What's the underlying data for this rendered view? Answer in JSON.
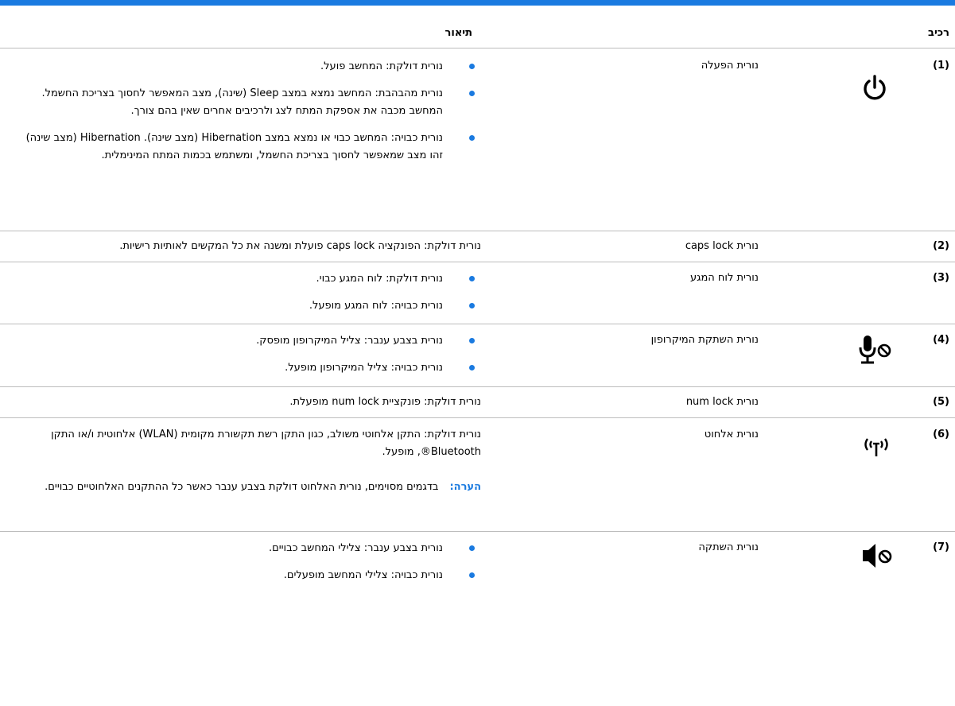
{
  "header": {
    "component": "רכיב",
    "description": "תיאור"
  },
  "rows": [
    {
      "num": "(1)",
      "component": "נורית הפעלה",
      "icon": "power-icon",
      "bullets": [
        "נורית דולקת: המחשב פועל.",
        "נורית מהבהבת: המחשב נמצא במצב Sleep (שינה), מצב המאפשר לחסוך בצריכת החשמל. המחשב מכבה את אספקת המתח לצג ולרכיבים אחרים שאין בהם צורך.",
        "נורית כבויה: המחשב כבוי או נמצא במצב Hibernation (מצב שינה). Hibernation (מצב שינה) זהו מצב שמאפשר לחסוך בצריכת החשמל, ומשתמש בכמות המתח המינימלית."
      ]
    },
    {
      "num": "(2)",
      "component": "נורית caps lock",
      "text": "נורית דולקת: הפונקציה caps lock פועלת ומשנה את כל המקשים לאותיות רישיות."
    },
    {
      "num": "(3)",
      "component": "נורית לוח המגע",
      "bullets": [
        "נורית דולקת: לוח המגע כבוי.",
        "נורית כבויה: לוח המגע מופעל."
      ]
    },
    {
      "num": "(4)",
      "component": "נורית השתקת המיקרופון",
      "icon": "microphone-mute-icon",
      "bullets": [
        "נורית בצבע ענבר: צליל המיקרופון מופסק.",
        "נורית כבויה: צליל המיקרופון מופעל."
      ]
    },
    {
      "num": "(5)",
      "component": "נורית num lock",
      "text": "נורית דולקת: פונקציית num lock מופעלת."
    },
    {
      "num": "(6)",
      "component": "נורית אלחוט",
      "icon": "wireless-icon",
      "text": "נורית דולקת: התקן אלחוטי משולב, כגון התקן רשת תקשורת מקומית (WLAN) אלחוטית ו/או התקן Bluetooth®, מופעל.",
      "note_label": "הערה:",
      "note": "בדגמים מסוימים, נורית האלחוט דולקת בצבע ענבר כאשר כל ההתקנים האלחוטיים כבויים."
    },
    {
      "num": "(7)",
      "component": "נורית השתקה",
      "icon": "speaker-mute-icon",
      "bullets": [
        "נורית בצבע ענבר: צלילי המחשב כבויים.",
        "נורית כבויה: צלילי המחשב מופעלים."
      ]
    }
  ]
}
